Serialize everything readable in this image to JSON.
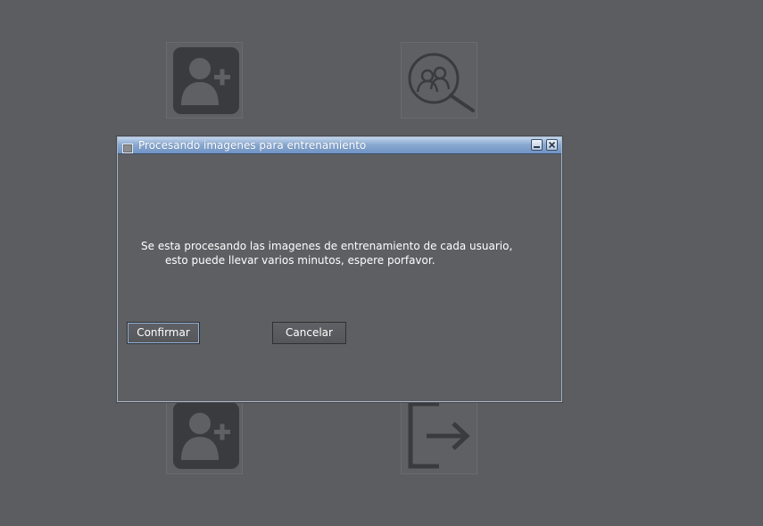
{
  "background_tiles": [
    {
      "name": "add-user-icon",
      "label": "add-user"
    },
    {
      "name": "search-users-icon",
      "label": "search-users"
    },
    {
      "name": "add-user-icon",
      "label": "add-user"
    },
    {
      "name": "logout-icon",
      "label": "logout"
    }
  ],
  "dialog": {
    "title": "Procesando imagenes para entrenamiento",
    "icon": "window-icon",
    "minimize_icon": "minimize-icon",
    "close_icon": "close-icon",
    "message_line1": "Se esta procesando las imagenes de entrenamiento de cada usuario,",
    "message_line2": "esto puede llevar varios minutos, espere porfavor.",
    "confirm_label": "Confirmar",
    "cancel_label": "Cancelar"
  },
  "colors": {
    "background": "#5c5d61",
    "titlebar_accent": "#7f9fca",
    "icon_fill": "#3a3b3e",
    "text": "#ffffff"
  }
}
